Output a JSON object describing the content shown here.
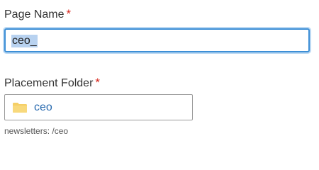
{
  "page_name": {
    "label": "Page Name",
    "required_marker": "*",
    "value": "ceo_"
  },
  "placement_folder": {
    "label": "Placement Folder",
    "required_marker": "*",
    "folder_name": "ceo",
    "path": "newsletters: /ceo",
    "icon": "folder-icon"
  },
  "colors": {
    "accent": "#3d8fd6",
    "required": "#d7281e",
    "folder": "#f5cf66",
    "link": "#2b6cb0"
  }
}
